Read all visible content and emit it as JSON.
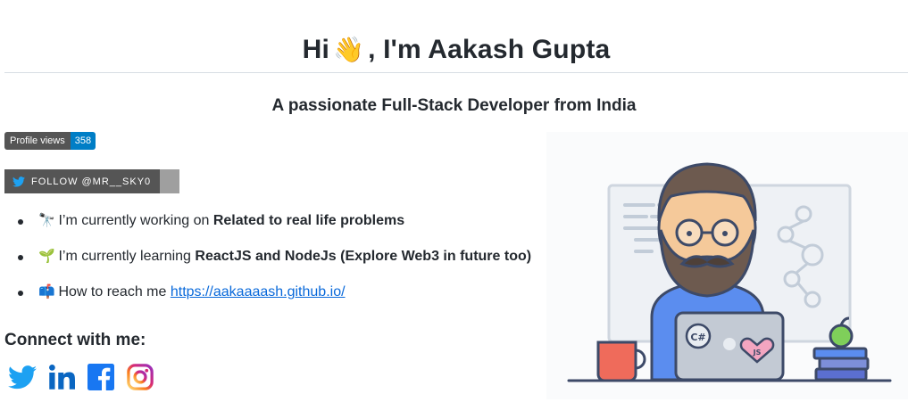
{
  "header": {
    "title_prefix": "Hi",
    "wave_emoji": "👋",
    "title_suffix": ", I'm Aakash Gupta",
    "subtitle": "A passionate Full-Stack Developer from India"
  },
  "badges": {
    "profile_views_label": "Profile views",
    "profile_views_count": "358",
    "twitter_follow_label": "FOLLOW @MR__SKY0"
  },
  "about": [
    {
      "emoji": "🔭",
      "text": "I’m currently working on ",
      "bold": "Related to real life problems"
    },
    {
      "emoji": "🌱",
      "text": "I’m currently learning ",
      "bold": "ReactJS and NodeJs (Explore Web3 in future too)"
    },
    {
      "emoji": "📫",
      "text": "How to reach me ",
      "link": "https://aakaaaash.github.io/"
    }
  ],
  "connect": {
    "heading": "Connect with me:",
    "icons": [
      "twitter-icon",
      "linkedin-icon",
      "facebook-icon",
      "instagram-icon"
    ]
  },
  "colors": {
    "twitter": "#1da1f2",
    "linkedin": "#0a66c2",
    "facebook": "#1877f2",
    "instagram": "#e1306c",
    "badge_dark": "#555555",
    "badge_blue": "#007ec6",
    "link": "#0969da"
  },
  "illustration": {
    "laptop_stickers": [
      "C#",
      "JS"
    ]
  }
}
